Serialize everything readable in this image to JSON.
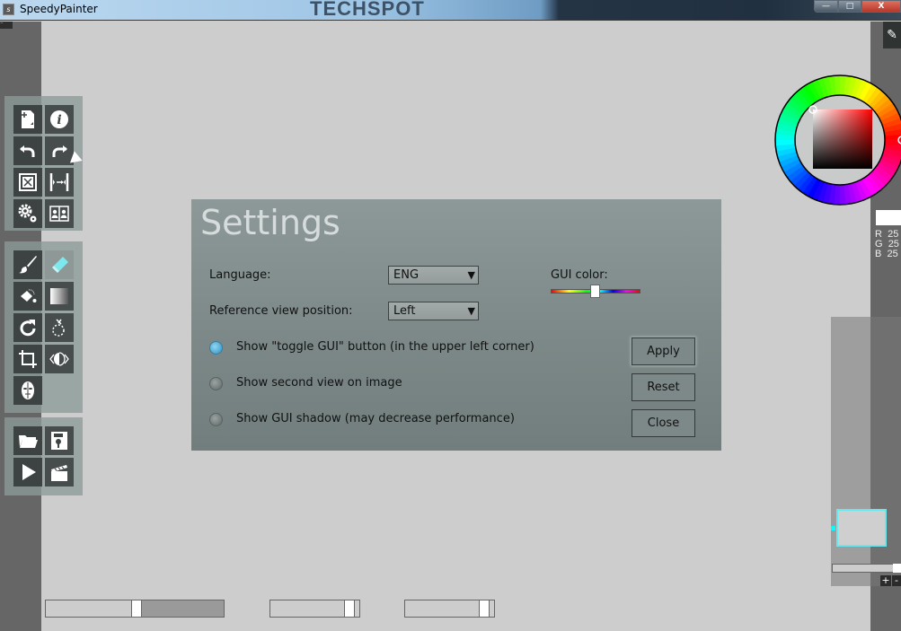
{
  "window": {
    "title": "SpeedyPainter",
    "watermark": "TECHSPOT",
    "controls": {
      "minimize": "—",
      "maximize": "□",
      "close": "X"
    }
  },
  "toggle_gui": {
    "icon": "toggle-gui-icon"
  },
  "toolbar": {
    "panel1": [
      {
        "name": "new-image",
        "icon": "new-page-icon"
      },
      {
        "name": "info",
        "icon": "info-icon"
      },
      {
        "name": "undo",
        "icon": "undo-icon"
      },
      {
        "name": "redo",
        "icon": "redo-icon"
      },
      {
        "name": "fit-view",
        "icon": "fit-screen-icon"
      },
      {
        "name": "flip-view",
        "icon": "flip-horizontal-icon"
      },
      {
        "name": "settings",
        "icon": "gears-icon"
      },
      {
        "name": "reference-view",
        "icon": "reference-view-icon"
      }
    ],
    "panel2": [
      {
        "name": "brush",
        "icon": "brush-icon"
      },
      {
        "name": "eraser",
        "icon": "eraser-icon",
        "active": true
      },
      {
        "name": "fill",
        "icon": "paint-bucket-icon"
      },
      {
        "name": "gradient",
        "icon": "gradient-icon"
      },
      {
        "name": "rotate",
        "icon": "rotate-icon"
      },
      {
        "name": "lasso",
        "icon": "lasso-icon"
      },
      {
        "name": "crop",
        "icon": "crop-icon"
      },
      {
        "name": "mirror",
        "icon": "mirror-icon"
      },
      {
        "name": "mask",
        "icon": "mask-icon"
      }
    ],
    "panel3": [
      {
        "name": "open",
        "icon": "folder-icon"
      },
      {
        "name": "save",
        "icon": "floppy-icon"
      },
      {
        "name": "play",
        "icon": "play-icon"
      },
      {
        "name": "record",
        "icon": "clapperboard-icon"
      }
    ]
  },
  "settings": {
    "title": "Settings",
    "language_label": "Language:",
    "language_value": "ENG",
    "reference_label": "Reference view position:",
    "reference_value": "Left",
    "gui_color_label": "GUI color:",
    "gui_color_hue_fraction": 0.5,
    "options": [
      {
        "label": "Show \"toggle GUI\" button (in the upper left corner)",
        "checked": true
      },
      {
        "label": "Show second view on image",
        "checked": false
      },
      {
        "label": "Show GUI shadow (may decrease performance)",
        "checked": false
      }
    ],
    "buttons": {
      "apply": "Apply",
      "reset": "Reset",
      "close": "Close"
    },
    "dropdown_arrow": "▼"
  },
  "color": {
    "current_hex": "#ffffff",
    "r_label": "R",
    "r_value": "25",
    "g_label": "G",
    "g_value": "25",
    "b_label": "B",
    "b_value": "25"
  },
  "navigator": {
    "zoom_in": "+",
    "zoom_out": "-",
    "zoom_fraction": 0.97
  },
  "bottom_sliders": [
    {
      "name": "brush-size",
      "value_fraction": 0.51
    },
    {
      "name": "opacity",
      "value_fraction": 0.94
    },
    {
      "name": "flow",
      "value_fraction": 0.94
    }
  ]
}
